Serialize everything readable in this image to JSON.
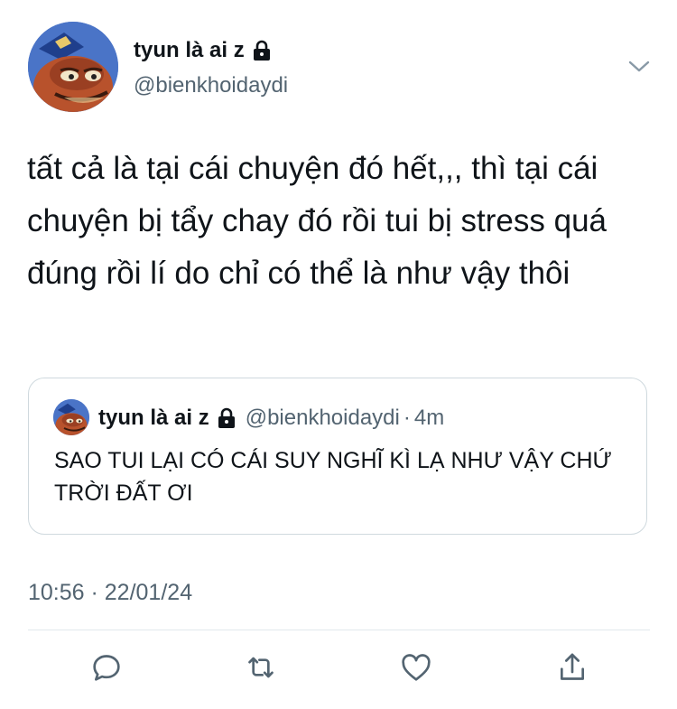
{
  "author": {
    "display_name": "tyun là ai z",
    "handle": "@bienkhoidaydi",
    "avatar_icon": "cartoon-fish-avatar",
    "protected_icon": "lock-icon"
  },
  "tweet": {
    "text": "tất cả là tại cái chuyện đó hết,,, thì tại cái chuyện bị tẩy chay đó rồi tui bị stress quá đúng rồi lí do chỉ có thể là như vậy thôi",
    "timestamp": "10:56 · 22/01/24"
  },
  "quoted_tweet": {
    "display_name": "tyun là ai z",
    "handle": "@bienkhoidaydi",
    "separator": "·",
    "time": "4m",
    "text": "SAO TUI LẠI CÓ CÁI SUY NGHĨ KÌ LẠ NHƯ VẬY CHỨ TRỜI ĐẤT ƠI"
  },
  "actions": [
    "reply-icon",
    "retweet-icon",
    "like-icon",
    "share-icon"
  ],
  "colors": {
    "text_primary": "#0f1419",
    "text_secondary": "#536471",
    "border": "#cfd9de",
    "icon": "#536471",
    "avatar_bg": "#4a74c7"
  }
}
